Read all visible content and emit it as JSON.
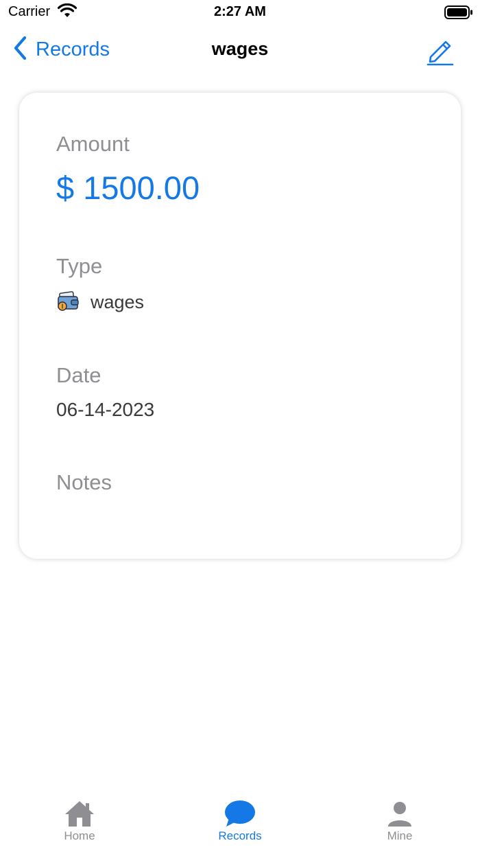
{
  "status_bar": {
    "carrier": "Carrier",
    "time": "2:27 AM"
  },
  "nav": {
    "back_label": "Records",
    "title": "wages",
    "edit_icon": "pencil-icon"
  },
  "record": {
    "amount_label": "Amount",
    "amount_value": "$ 1500.00",
    "type_label": "Type",
    "type_icon": "wallet-icon",
    "type_value": "wages",
    "date_label": "Date",
    "date_value": "06-14-2023",
    "notes_label": "Notes"
  },
  "tabs": [
    {
      "label": "Home",
      "icon": "home-icon",
      "active": false
    },
    {
      "label": "Records",
      "icon": "chat-bubble-icon",
      "active": true
    },
    {
      "label": "Mine",
      "icon": "person-icon",
      "active": false
    }
  ],
  "colors": {
    "accent": "#1479e6",
    "label_gray": "#8e8e93",
    "text_dark": "#3a3a3c"
  }
}
